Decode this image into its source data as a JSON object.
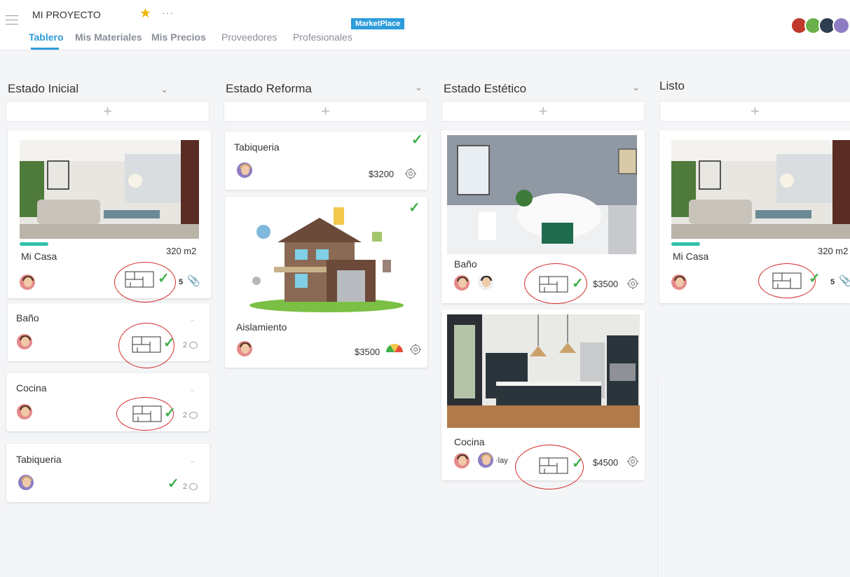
{
  "header": {
    "project_title": "MI PROYECTO",
    "more_label": "···",
    "marketplace_badge": "MarketPlace",
    "tabs": [
      {
        "label": "Tablero"
      },
      {
        "label": "Mis Materiales"
      },
      {
        "label": "Mis Precios"
      },
      {
        "label": "Proveedores"
      },
      {
        "label": "Profesionales"
      }
    ]
  },
  "columns": [
    {
      "title": "Estado Inicial",
      "add_label": "+",
      "cards": [
        {
          "title": "Mi Casa",
          "area": "320 m2",
          "progress": 0.15,
          "attachments": "5"
        },
        {
          "title": "Baño",
          "comments": "2"
        },
        {
          "title": "Cocina",
          "comments": "2"
        },
        {
          "title": "Tabiqueria",
          "comments": "2"
        }
      ]
    },
    {
      "title": "Estado Reforma",
      "add_label": "+",
      "cards": [
        {
          "title": "Tabiqueria",
          "price": "$3200"
        },
        {
          "title": "Aislamiento",
          "price": "$3500"
        }
      ]
    },
    {
      "title": "Estado Estético",
      "add_label": "+",
      "cards": [
        {
          "title": "Baño",
          "price": "$3500"
        },
        {
          "title": "Cocina",
          "price": "$4500",
          "assignee": "·lay"
        }
      ]
    },
    {
      "title": "Listo",
      "add_label": "+",
      "cards": [
        {
          "title": "Mi Casa",
          "area": "320 m2",
          "progress": 0.15,
          "attachments": "5"
        }
      ]
    }
  ],
  "colors": {
    "accent": "#2d9cdb",
    "success": "#3fb04c",
    "progress": "#2fc1a8",
    "annotation": "#d42a2a"
  }
}
